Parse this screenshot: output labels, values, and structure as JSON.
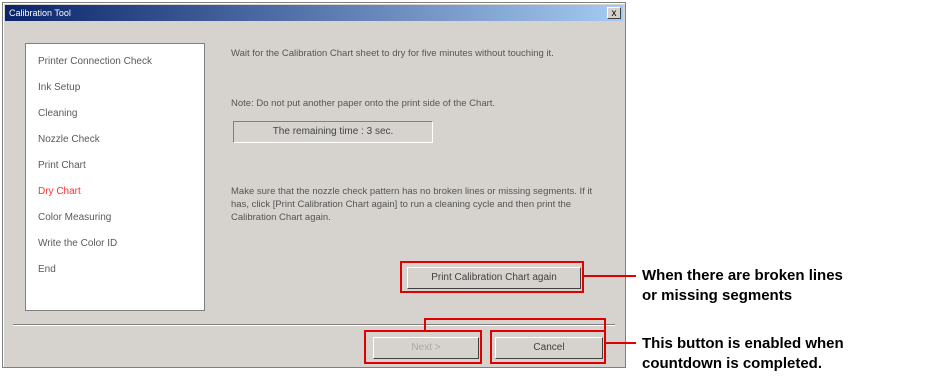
{
  "window": {
    "title": "Calibration Tool",
    "close_label": "x"
  },
  "steps": [
    {
      "label": "Printer Connection Check",
      "active": false
    },
    {
      "label": "Ink Setup",
      "active": false
    },
    {
      "label": "Cleaning",
      "active": false
    },
    {
      "label": "Nozzle Check",
      "active": false
    },
    {
      "label": "Print Chart",
      "active": false
    },
    {
      "label": "Dry Chart",
      "active": true
    },
    {
      "label": "Color Measuring",
      "active": false
    },
    {
      "label": "Write the Color ID",
      "active": false
    },
    {
      "label": "End",
      "active": false
    }
  ],
  "content": {
    "instruction": "Wait for the Calibration Chart sheet to dry for five minutes without touching it.",
    "note": "Note: Do not put another paper onto the print side of the Chart.",
    "timer_text": "The remaining time : 3 sec.",
    "check_text": "Make sure that the nozzle check pattern has no broken lines or missing segments. If it has, click [Print Calibration Chart again] to run a cleaning cycle and then print the Calibration Chart again."
  },
  "buttons": {
    "print_again": "Print Calibration Chart again",
    "next": "Next >",
    "cancel": "Cancel"
  },
  "callouts": {
    "broken_lines_1": "When there are broken lines",
    "broken_lines_2": "or missing segments",
    "enabled_1": "This button is enabled when",
    "enabled_2": "countdown is completed."
  },
  "colors": {
    "highlight": "#e00000",
    "active_step": "#ff3030",
    "dialog_bg": "#d6d3ce"
  }
}
